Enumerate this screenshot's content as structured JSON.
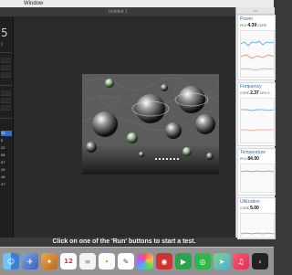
{
  "menubar": {
    "app_menu": "Window"
  },
  "app_window": {
    "title": "Untitled 1",
    "status_text": "Click on one of the 'Run' buttons to start a test.",
    "left_panel": {
      "big_number": "5",
      "sub_label": "ll",
      "values": [
        "75",
        "6",
        "22",
        "08",
        "87",
        "29",
        "45",
        "47"
      ]
    }
  },
  "monitor": {
    "panels": [
      {
        "title": "Power",
        "label_a": "PKG",
        "value_a": "4.39",
        "label_b": "CORE",
        "value_b": "..."
      },
      {
        "title": "Frequency",
        "label_a": "CORE",
        "value_a": "2.37",
        "label_b": "GPU",
        "value_b": "0..."
      },
      {
        "title": "Temperature",
        "label_a": "PKG",
        "value_a": "84.00",
        "label_b": "",
        "value_b": ""
      },
      {
        "title": "Utilization",
        "label_a": "CORE",
        "value_a": "5.00",
        "label_b": "",
        "value_b": ""
      }
    ]
  },
  "dock": {
    "calendar_day": "12",
    "items": [
      "finder-icon",
      "launchpad-icon",
      "safari-icon",
      "notes-icon",
      "calendar-icon",
      "reminders-icon",
      "textedit-icon",
      "photos-icon",
      "photobooth-icon",
      "facetime-icon",
      "messages-icon",
      "maps-icon",
      "music-icon",
      "books-icon",
      "appstore-icon",
      "settings-icon",
      "terminal-icon",
      "pages-icon",
      "monitor-app-icon"
    ]
  }
}
